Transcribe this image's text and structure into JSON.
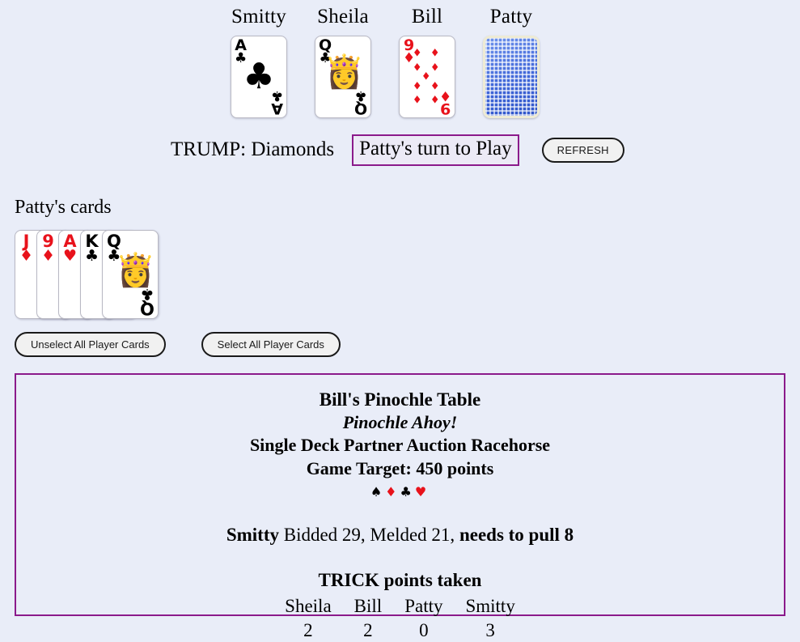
{
  "table": {
    "seats": [
      {
        "name": "Smitty",
        "card": {
          "rank": "A",
          "suit": "♣",
          "color": "black",
          "kind": "pip",
          "center": "♣"
        }
      },
      {
        "name": "Sheila",
        "card": {
          "rank": "Q",
          "suit": "♣",
          "color": "black",
          "kind": "face",
          "emoji": "👸"
        }
      },
      {
        "name": "Bill",
        "card": {
          "rank": "9",
          "suit": "♦",
          "color": "red",
          "kind": "nine",
          "center": "♦"
        }
      },
      {
        "name": "Patty",
        "card": {
          "rank": "",
          "suit": "",
          "color": "",
          "kind": "back",
          "center": ""
        }
      }
    ]
  },
  "status": {
    "trump": "TRUMP: Diamonds",
    "turn": "Patty's turn to Play",
    "refresh_label": "REFRESH"
  },
  "hand": {
    "title": "Patty's cards",
    "cards": [
      {
        "rank": "J",
        "suit": "♦",
        "color": "red",
        "kind": "plain"
      },
      {
        "rank": "9",
        "suit": "♦",
        "color": "red",
        "kind": "plain"
      },
      {
        "rank": "A",
        "suit": "♥",
        "color": "red",
        "kind": "plain"
      },
      {
        "rank": "K",
        "suit": "♣",
        "color": "black",
        "kind": "plain"
      },
      {
        "rank": "Q",
        "suit": "♣",
        "color": "black",
        "kind": "face",
        "emoji": "👸"
      }
    ],
    "unselect_label": "Unselect All Player Cards",
    "select_label": "Select All Player Cards"
  },
  "info": {
    "title": "Bill's Pinochle Table",
    "subtitle": "Pinochle Ahoy!",
    "mode": "Single Deck Partner Auction Racehorse",
    "target": "Game Target: 450 points",
    "suits": [
      {
        "glyph": "♠",
        "color": "black"
      },
      {
        "glyph": "♦",
        "color": "red"
      },
      {
        "glyph": "♣",
        "color": "black"
      },
      {
        "glyph": "♥",
        "color": "red"
      }
    ],
    "bid": {
      "bidder": "Smitty",
      "middle": " Bidded 29, Melded 21, ",
      "need": "needs to pull 8"
    },
    "trick": {
      "heading": "TRICK points taken",
      "names": [
        "Sheila",
        "Bill",
        "Patty",
        "Smitty"
      ],
      "values": [
        "2",
        "2",
        "0",
        "3"
      ]
    }
  },
  "colors": {
    "background": "#e9edf8",
    "accent": "#8b1a8b",
    "red_suit": "#e8121b",
    "card_back": "#4a74e0"
  }
}
